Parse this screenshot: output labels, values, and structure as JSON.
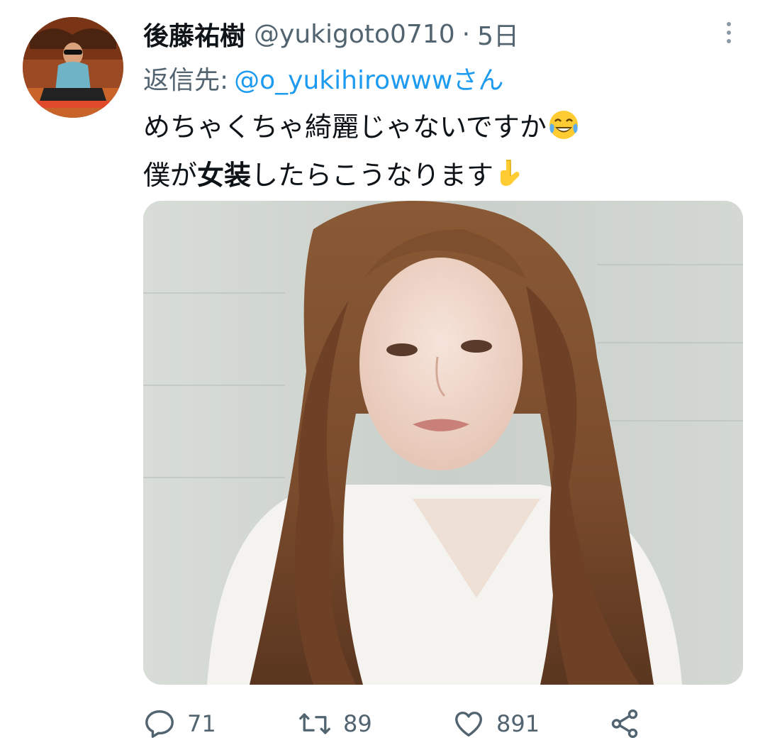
{
  "tweet": {
    "author": {
      "display_name": "後藤祐樹",
      "handle": "@yukigoto0710",
      "avatar_icon": "profile-avatar"
    },
    "separator": "·",
    "time": "5日",
    "reply": {
      "prefix": "返信先:",
      "target": "@o_yukihirowwwさん"
    },
    "text": {
      "line1": "めちゃくちゃ綺麗じゃないですか",
      "line1_emoji": "face-with-tears-of-joy",
      "line2_before": "僕が",
      "line2_bold": "女装",
      "line2_after": "したらこうなります",
      "line2_emoji": "backhand-index-pointing-down"
    },
    "media": {
      "kind": "photo"
    },
    "stats": {
      "replies": "71",
      "retweets": "89",
      "likes": "891"
    }
  },
  "colors": {
    "text_primary": "#0f1419",
    "text_secondary": "#536471",
    "link": "#1d9bf0"
  },
  "icons": {
    "more": "more-vertical-icon",
    "reply": "reply-icon",
    "retweet": "retweet-icon",
    "like": "heart-icon",
    "share": "share-icon"
  }
}
